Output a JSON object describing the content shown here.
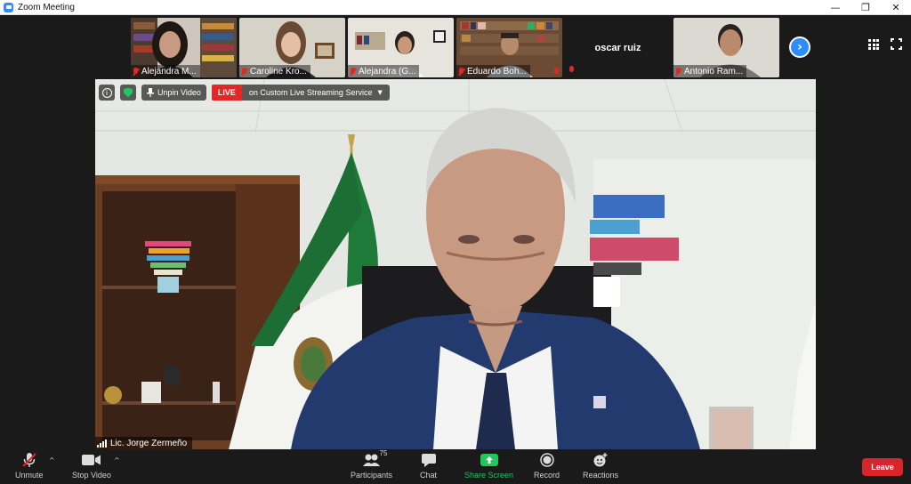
{
  "window": {
    "title": "Zoom Meeting",
    "minimize": "—",
    "restore": "❐",
    "close": "✕"
  },
  "participants_strip": [
    {
      "name": "Alejandra M..."
    },
    {
      "name": "Caroline Kro..."
    },
    {
      "name": "Alejandra (G..."
    },
    {
      "name": "Eduardo Boh..."
    },
    {
      "name": "oscar ruiz"
    },
    {
      "name": "Antonio Ram..."
    }
  ],
  "main_video": {
    "unpin_label": "Unpin Video",
    "live_label": "LIVE",
    "stream_label": "on Custom Live Streaming Service",
    "speaker_name": "Lic. Jorge Zermeño"
  },
  "toolbar": {
    "unmute": "Unmute",
    "stop_video": "Stop Video",
    "participants": "Participants",
    "participants_count": "75",
    "chat": "Chat",
    "share_screen": "Share Screen",
    "record": "Record",
    "reactions": "Reactions",
    "leave": "Leave"
  },
  "colors": {
    "accent": "#2d8cff",
    "live": "#e02828",
    "share": "#23c55e",
    "leave": "#d7252a"
  }
}
